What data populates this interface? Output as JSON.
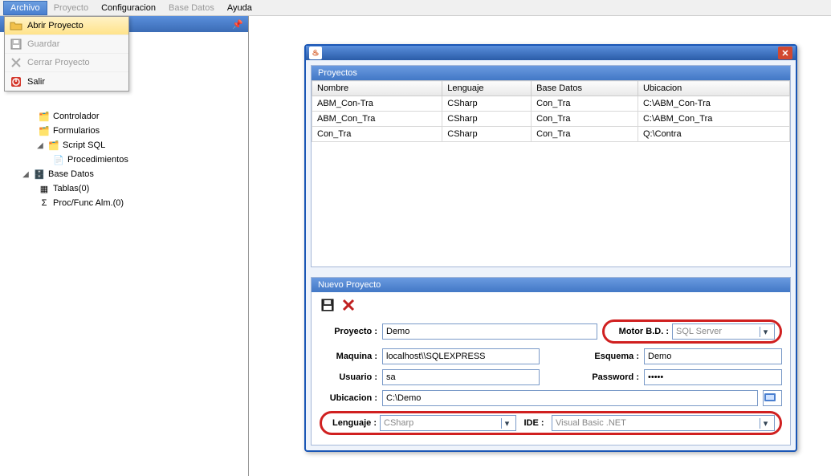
{
  "menu": {
    "archivo": "Archivo",
    "proyecto": "Proyecto",
    "configuracion": "Configuracion",
    "base_datos": "Base Datos",
    "ayuda": "Ayuda"
  },
  "dropdown": {
    "abrir": "Abrir Proyecto",
    "guardar": "Guardar",
    "cerrar": "Cerrar Proyecto",
    "salir": "Salir"
  },
  "sidebar": {
    "controlador": "Controlador",
    "formularios": "Formularios",
    "script_sql": "Script SQL",
    "procedimientos": "Procedimientos",
    "base_datos": "Base Datos",
    "tablas": "Tablas(0)",
    "proc_func": "Proc/Func Alm.(0)"
  },
  "dialog": {
    "projects_title": "Proyectos",
    "col_nombre": "Nombre",
    "col_lenguaje": "Lenguaje",
    "col_basedatos": "Base Datos",
    "col_ubicacion": "Ubicacion",
    "rows": [
      {
        "nombre": "ABM_Con-Tra",
        "lenguaje": "CSharp",
        "bd": "Con_Tra",
        "ubi": "C:\\ABM_Con-Tra"
      },
      {
        "nombre": "ABM_Con_Tra",
        "lenguaje": "CSharp",
        "bd": "Con_Tra",
        "ubi": "C:\\ABM_Con_Tra"
      },
      {
        "nombre": "Con_Tra",
        "lenguaje": "CSharp",
        "bd": "Con_Tra",
        "ubi": "Q:\\Contra"
      }
    ],
    "new_title": "Nuevo Proyecto",
    "labels": {
      "proyecto": "Proyecto :",
      "motor": "Motor B.D. :",
      "maquina": "Maquina :",
      "esquema": "Esquema :",
      "usuario": "Usuario :",
      "password": "Password :",
      "ubicacion": "Ubicacion :",
      "lenguaje": "Lenguaje :",
      "ide": "IDE :"
    },
    "values": {
      "proyecto": "Demo",
      "motor": "SQL Server",
      "maquina": "localhost\\\\SQLEXPRESS",
      "esquema": "Demo",
      "usuario": "sa",
      "password": "•••••",
      "ubicacion": "C:\\Demo",
      "lenguaje": "CSharp",
      "ide": "Visual Basic .NET"
    }
  }
}
